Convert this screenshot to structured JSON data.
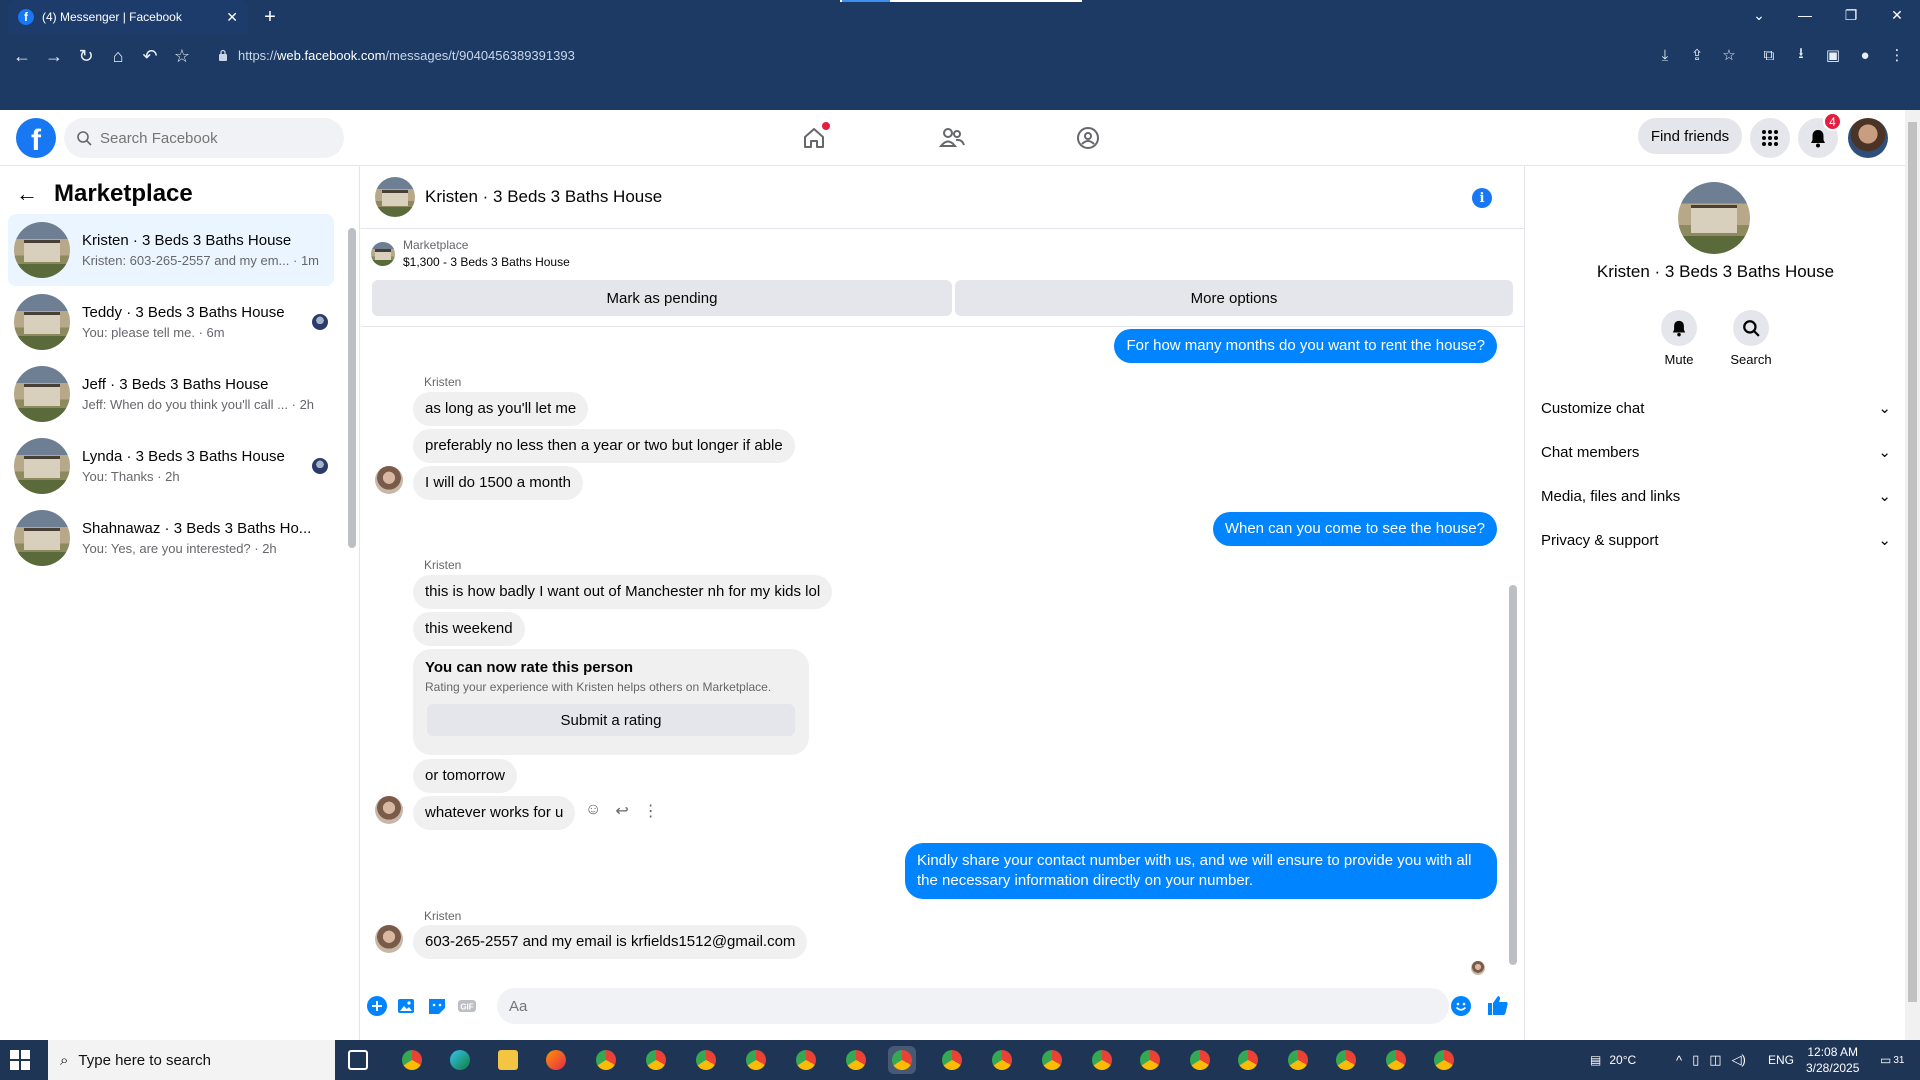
{
  "browser": {
    "tab_title": "(4) Messenger | Facebook",
    "url_prefix": "https://",
    "url_domain": "web.facebook.com",
    "url_path": "/messages/t/9040456389391393"
  },
  "fb": {
    "search_placeholder": "Search Facebook",
    "find_friends": "Find friends",
    "notifications_count": "4"
  },
  "left": {
    "title": "Marketplace",
    "conversations": [
      {
        "name": "Kristen · 3 Beds 3 Baths House",
        "preview": "Kristen: 603-265-2557 and my em... · 1m"
      },
      {
        "name": "Teddy · 3 Beds 3 Baths House",
        "preview": "You: please tell me. · 6m"
      },
      {
        "name": "Jeff · 3 Beds 3 Baths House",
        "preview": "Jeff: When do you think you'll call ... · 2h"
      },
      {
        "name": "Lynda · 3 Beds 3 Baths House",
        "preview": "You: Thanks · 2h"
      },
      {
        "name": "Shahnawaz · 3 Beds 3 Baths Ho...",
        "preview": "You: Yes, are you interested? · 2h"
      }
    ]
  },
  "chat": {
    "title": "Kristen · 3 Beds 3 Baths House",
    "listing_label": "Marketplace",
    "listing_price": "$1,300 - 3 Beds 3 Baths House",
    "mark_pending": "Mark as pending",
    "more_options": "More options",
    "messages": {
      "m1": "For how many months do you want to rent the house?",
      "s1": "Kristen",
      "m2": "as long as you'll let me",
      "m3": "preferably no less then a year or two but longer if able",
      "m4": "I will do 1500 a month",
      "m5": "When can you come to see the house?",
      "s2": "Kristen",
      "m6": "this is how badly I want out of Manchester nh for my kids lol",
      "m7": "this weekend",
      "m8": "or tomorrow",
      "m9": "whatever works for u",
      "m10a": "Kindly share your contact number with us, and we will ensure to provide you with all",
      "m10b": "the necessary information directly on your number.",
      "s3": "Kristen",
      "m11": "603-265-2557 and my email is krfields1512@gmail.com"
    },
    "rating": {
      "heading": "You can now rate this person",
      "sub": "Rating your experience with Kristen helps others on Marketplace.",
      "button": "Submit a rating"
    },
    "composer_placeholder": "Aa"
  },
  "right": {
    "name": "Kristen · 3 Beds 3 Baths House",
    "mute": "Mute",
    "search": "Search",
    "rows": [
      "Customize chat",
      "Chat members",
      "Media, files and links",
      "Privacy & support"
    ]
  },
  "taskbar": {
    "search_placeholder": "Type here to search",
    "temp": "20°C",
    "lang": "ENG",
    "time": "12:08 AM",
    "date": "3/28/2025",
    "notif": "31"
  },
  "colors": {
    "fb_blue": "#1877f2",
    "messenger_blue": "#0084ff",
    "chrome_bg": "#1c3a63",
    "taskbar_bg": "#1f3556"
  }
}
